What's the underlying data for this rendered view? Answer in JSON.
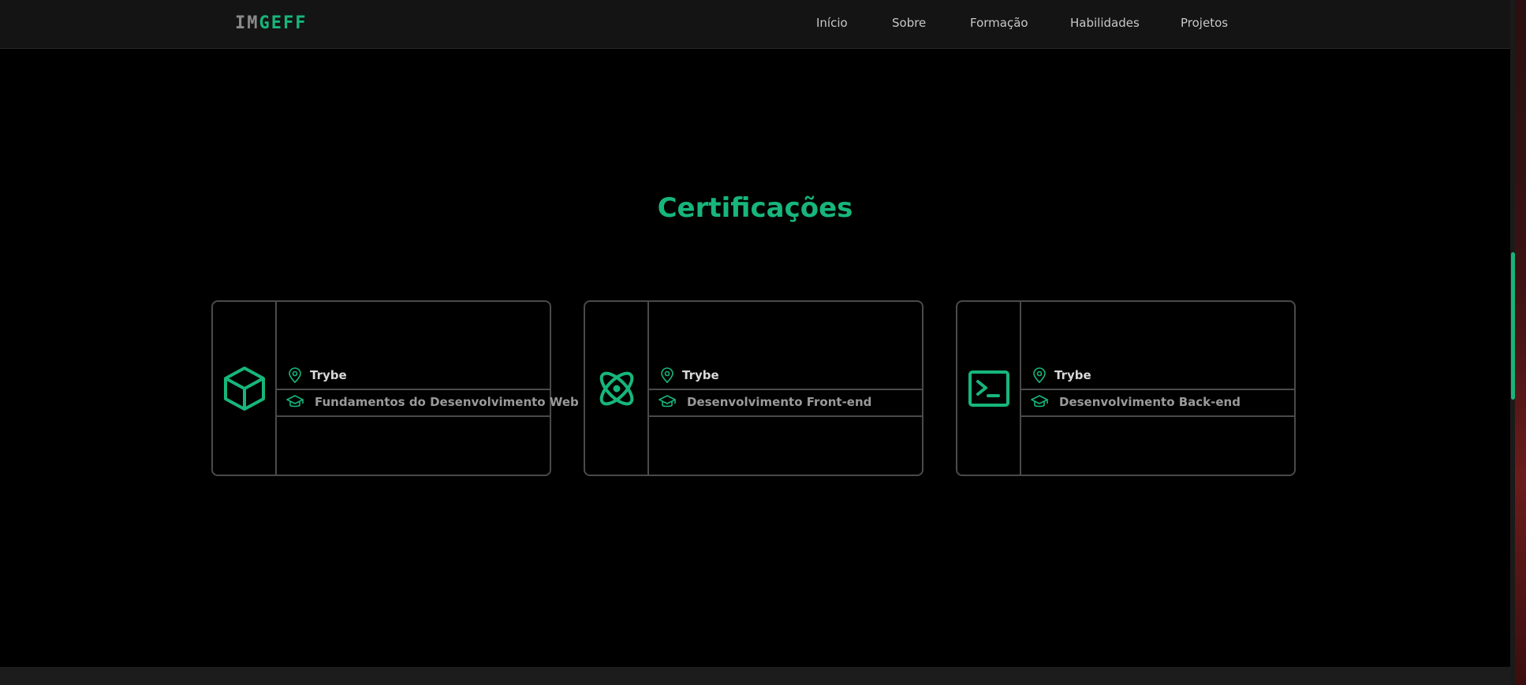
{
  "header": {
    "logo_part1": "IM",
    "logo_part2": "GEFF",
    "nav": [
      "Início",
      "Sobre",
      "Formação",
      "Habilidades",
      "Projetos"
    ]
  },
  "section": {
    "title": "Certificações"
  },
  "cards": [
    {
      "icon": "cube-icon",
      "institution": "Trybe",
      "course": "Fundamentos do Desenvolvimento Web"
    },
    {
      "icon": "atom-icon",
      "institution": "Trybe",
      "course": "Desenvolvimento Front-end"
    },
    {
      "icon": "terminal-icon",
      "institution": "Trybe",
      "course": "Desenvolvimento Back-end"
    }
  ],
  "colors": {
    "accent": "#17b67b",
    "background": "#000000",
    "header": "#141414",
    "border": "#4a4a4a"
  }
}
